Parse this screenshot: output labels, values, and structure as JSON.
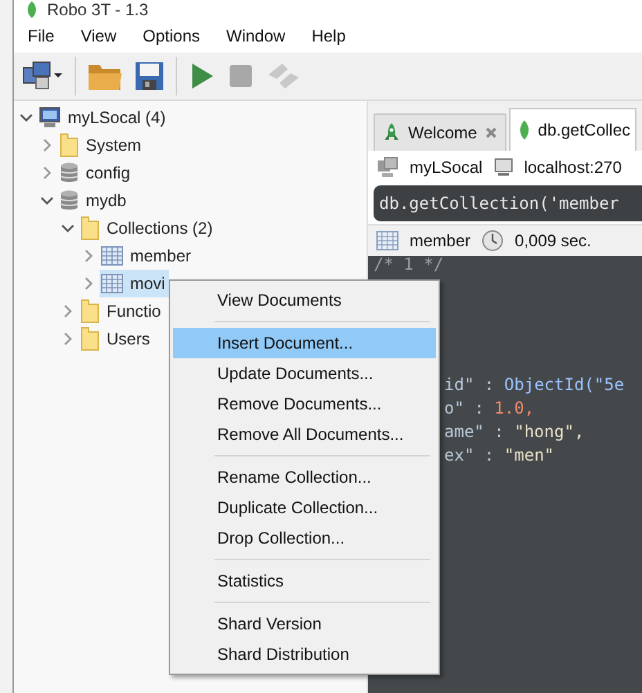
{
  "window": {
    "title": "Robo 3T - 1.3"
  },
  "menu_bar": [
    "File",
    "View",
    "Options",
    "Window",
    "Help"
  ],
  "toolbar": [
    {
      "kind": "connect"
    },
    {
      "kind": "open"
    },
    {
      "kind": "save"
    },
    {
      "kind": "run",
      "disabled": false
    },
    {
      "kind": "stop",
      "disabled": true
    },
    {
      "kind": "format",
      "disabled": true
    }
  ],
  "tree": [
    {
      "kind": "server",
      "label": "myLSocal (4)",
      "expanded": true,
      "selected": false,
      "children": [
        {
          "kind": "folder",
          "label": "System",
          "expanded": false,
          "selected": false
        },
        {
          "kind": "database",
          "label": "config",
          "expanded": false,
          "selected": false
        },
        {
          "kind": "database",
          "label": "mydb",
          "expanded": true,
          "selected": false,
          "children": [
            {
              "kind": "folder",
              "label": "Collections (2)",
              "expanded": true,
              "selected": false,
              "children": [
                {
                  "kind": "collection",
                  "label": "member",
                  "expanded": false,
                  "selected": false
                },
                {
                  "kind": "collection",
                  "label": "movi",
                  "expanded": false,
                  "selected": true
                }
              ]
            },
            {
              "kind": "folder",
              "label": "Functio",
              "expanded": false,
              "selected": false
            },
            {
              "kind": "folder",
              "label": "Users",
              "expanded": false,
              "selected": false
            }
          ]
        }
      ]
    }
  ],
  "tabs": [
    {
      "label": "Welcome",
      "closable": true,
      "selected": false
    },
    {
      "label": "db.getCollec",
      "closable": false,
      "selected": true
    }
  ],
  "info_bar": {
    "connection": "myLSocal",
    "server": "localhost:270"
  },
  "query": "db.getCollection('member",
  "result_bar": {
    "collection": "member",
    "time": "0,009 sec."
  },
  "code_comment": "/* 1 */",
  "code_lines": [
    {
      "key": "id\"",
      "sep": ":",
      "value": "ObjectId(\"5e",
      "kind": "object"
    },
    {
      "key": "o\"",
      "sep": ":",
      "value": "1.0,",
      "kind": "number"
    },
    {
      "key": "ame\"",
      "sep": ":",
      "value": "\"hong\",",
      "kind": "string"
    },
    {
      "key": "ex\"",
      "sep": ":",
      "value": "\"men\"",
      "kind": "string"
    }
  ],
  "context_menu": [
    [
      {
        "label": "View Documents",
        "selected": false
      }
    ],
    [
      {
        "label": "Insert Document...",
        "selected": true
      },
      {
        "label": "Update Documents...",
        "selected": false
      },
      {
        "label": "Remove Documents...",
        "selected": false
      },
      {
        "label": "Remove All Documents...",
        "selected": false
      }
    ],
    [
      {
        "label": "Rename Collection...",
        "selected": false
      },
      {
        "label": "Duplicate Collection...",
        "selected": false
      },
      {
        "label": "Drop Collection...",
        "selected": false
      }
    ],
    [
      {
        "label": "Statistics",
        "selected": false
      }
    ],
    [
      {
        "label": "Shard Version",
        "selected": false
      },
      {
        "label": "Shard Distribution",
        "selected": false
      }
    ]
  ]
}
